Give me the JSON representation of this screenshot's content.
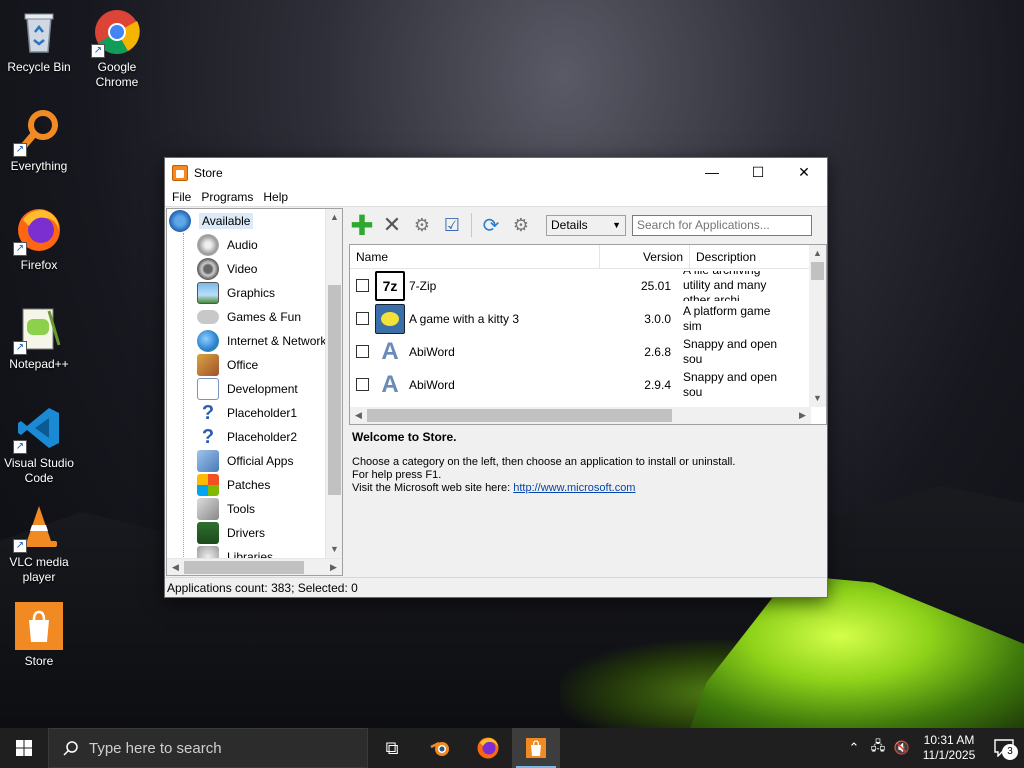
{
  "desktop": {
    "icons": [
      {
        "label": "Recycle Bin",
        "icon": "recycle-bin-icon"
      },
      {
        "label": "Google Chrome",
        "icon": "chrome-icon"
      },
      {
        "label": "Everything",
        "icon": "everything-search-icon"
      },
      {
        "label": "Firefox",
        "icon": "firefox-icon"
      },
      {
        "label": "Notepad++",
        "icon": "notepadpp-icon"
      },
      {
        "label": "Visual Studio Code",
        "icon": "vscode-icon"
      },
      {
        "label": "VLC media player",
        "icon": "vlc-icon"
      },
      {
        "label": "Store",
        "icon": "store-icon"
      }
    ]
  },
  "window": {
    "title": "Store",
    "controls": {
      "minimize": "—",
      "maximize": "☐",
      "close": "✕"
    },
    "menu": [
      "File",
      "Programs",
      "Help"
    ],
    "tree": {
      "root": "Available",
      "items": [
        "Audio",
        "Video",
        "Graphics",
        "Games & Fun",
        "Internet & Network",
        "Office",
        "Development",
        "Placeholder1",
        "Placeholder2",
        "Official Apps",
        "Patches",
        "Tools",
        "Drivers",
        "Libraries"
      ]
    },
    "toolbar": {
      "view_select": "Details",
      "search_placeholder": "Search for Applications..."
    },
    "list": {
      "columns": {
        "name": "Name",
        "version": "Version",
        "description": "Description"
      },
      "rows": [
        {
          "name": "7-Zip",
          "version": "25.01",
          "description": "A file archiving utility and many other archi"
        },
        {
          "name": "A game with a kitty 3",
          "version": "3.0.0",
          "description": "A platform game sim"
        },
        {
          "name": "AbiWord",
          "version": "2.6.8",
          "description": "Snappy and open sou"
        },
        {
          "name": "AbiWord",
          "version": "2.9.4",
          "description": "Snappy and open sou"
        }
      ]
    },
    "info": {
      "welcome": "Welcome to Store.",
      "line1": "Choose a category on the left, then choose an application to install or uninstall.",
      "line2": "For help press F1.",
      "line3": "Visit the Microsoft web site here:",
      "link": "http://www.microsoft.com"
    },
    "status": "Applications count: 383; Selected: 0"
  },
  "taskbar": {
    "search_placeholder": "Type here to search",
    "time": "10:31 AM",
    "date": "11/1/2025",
    "notification_count": "3"
  },
  "colors": {
    "accent": "#0078d7",
    "store_orange": "#f28a24",
    "add_green": "#2ea82e",
    "link_blue": "#0645ad"
  }
}
